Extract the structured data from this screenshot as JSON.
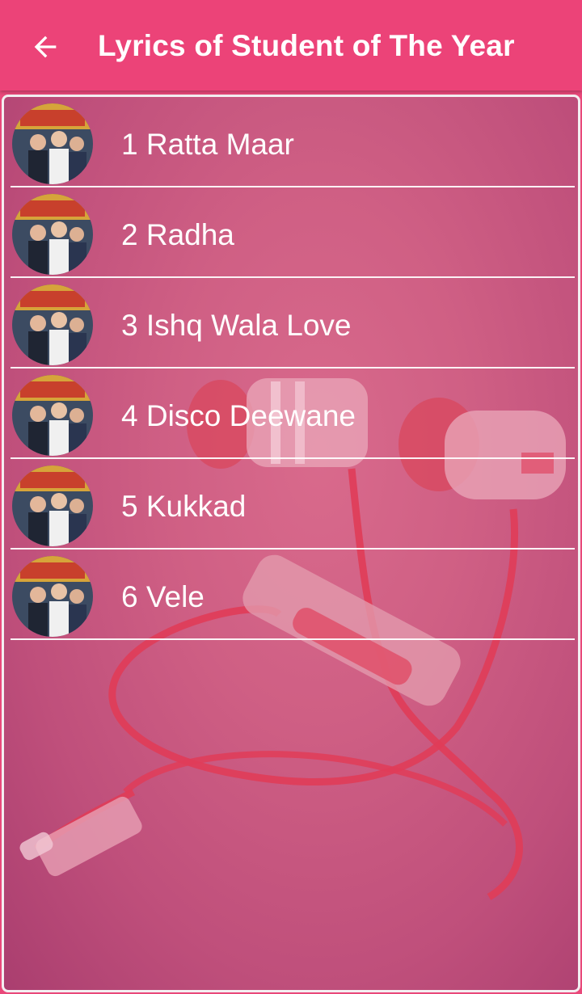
{
  "appbar": {
    "title": "Lyrics of Student of The Year",
    "back_icon": "arrow-left-icon"
  },
  "colors": {
    "appbar": "#ec4378",
    "background": "#cf5f84",
    "text": "#ffffff",
    "divider": "#ffffff"
  },
  "songs": [
    {
      "label": "1 Ratta Maar"
    },
    {
      "label": "2 Radha"
    },
    {
      "label": "3 Ishq Wala Love"
    },
    {
      "label": "4 Disco Deewane"
    },
    {
      "label": "5 Kukkad"
    },
    {
      "label": "6 Vele"
    }
  ]
}
